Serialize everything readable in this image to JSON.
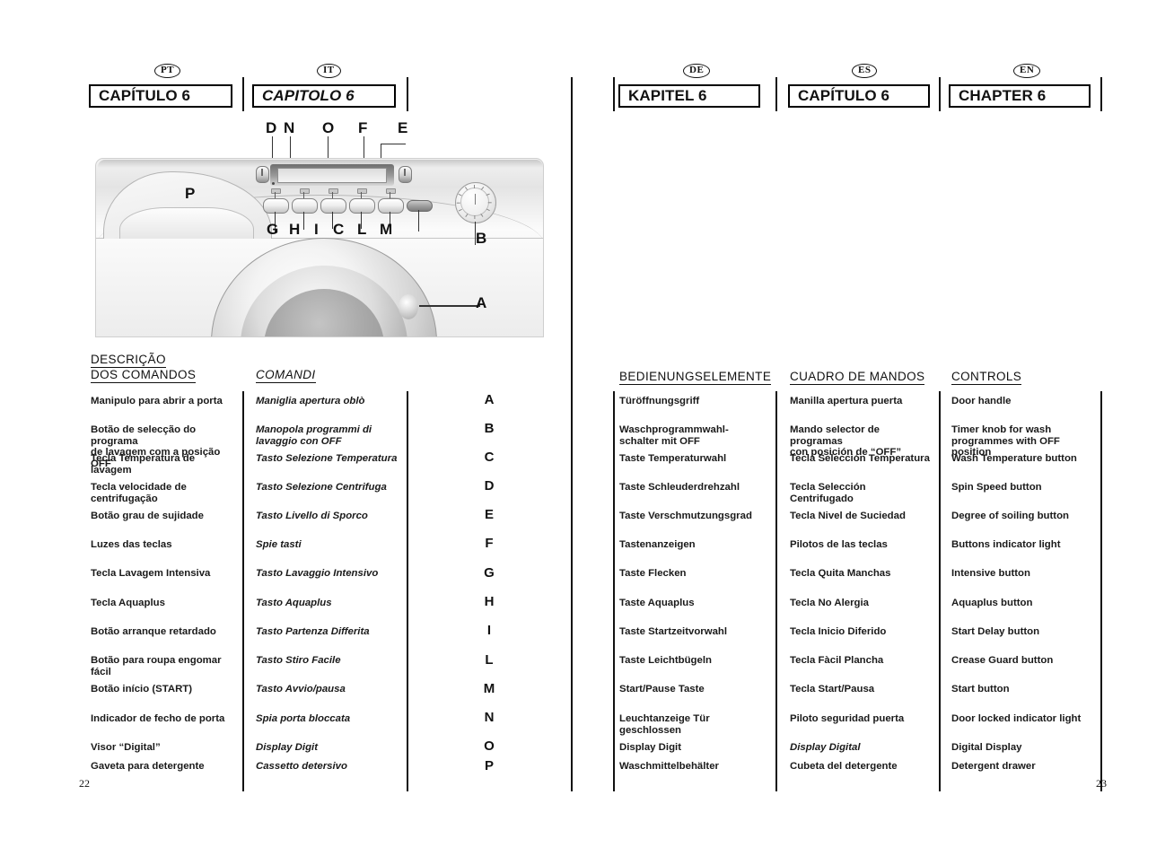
{
  "document": {
    "left_page_number": "22",
    "right_page_number": "23"
  },
  "languages": [
    {
      "code": "PT",
      "chapter": "CAPÍTULO 6",
      "italic": false
    },
    {
      "code": "IT",
      "chapter": "CAPITOLO 6",
      "italic": true
    },
    {
      "code": "DE",
      "chapter": "KAPITEL 6",
      "italic": false
    },
    {
      "code": "ES",
      "chapter": "CAPÍTULO 6",
      "italic": false
    },
    {
      "code": "EN",
      "chapter": "CHAPTER 6",
      "italic": false
    }
  ],
  "section_headings": {
    "pt": "DESCRIÇÃO\nDOS COMANDOS",
    "it": "COMANDI",
    "de": "BEDIENUNGSELEMENTE",
    "es": "CUADRO DE MANDOS",
    "en": "CONTROLS"
  },
  "key_letters": [
    "A",
    "B",
    "C",
    "D",
    "E",
    "F",
    "G",
    "H",
    "I",
    "L",
    "M",
    "N",
    "O",
    "P"
  ],
  "controls": [
    {
      "key": "A",
      "pt": "Manipulo para abrir a porta",
      "it": "Maniglia apertura oblò",
      "de": "Türöffnungsgriff",
      "es": "Manilla apertura puerta",
      "en": "Door handle"
    },
    {
      "key": "B",
      "pt": "Botão de selecção do programa\nde lavagem com a posição OFF",
      "it": "Manopola programmi di\nlavaggio con OFF",
      "de": "Waschprogrammwahl-\nschalter mit OFF",
      "es": "Mando selector de programas\ncon posición de “OFF”",
      "en": "Timer knob for wash\nprogrammes with OFF position"
    },
    {
      "key": "C",
      "pt": "Tecla Temperatura de\nlavagem",
      "it": "Tasto Selezione Temperatura",
      "de": "Taste Temperaturwahl",
      "es": "Tecla Selección Temperatura",
      "en": "Wash Temperature button"
    },
    {
      "key": "D",
      "pt": "Tecla velocidade de\ncentrifugação",
      "it": "Tasto Selezione Centrifuga",
      "de": "Taste Schleuderdrehzahl",
      "es": "Tecla Selección\nCentrifugado",
      "en": "Spin Speed button"
    },
    {
      "key": "E",
      "pt": "Botão grau de sujidade",
      "it": "Tasto Livello di Sporco",
      "de": "Taste Verschmutzungsgrad",
      "es": "Tecla Nivel de Suciedad",
      "en": "Degree of soiling button"
    },
    {
      "key": "F",
      "pt": "Luzes das teclas",
      "it": "Spie tasti",
      "de": "Tastenanzeigen",
      "es": "Pilotos de las teclas",
      "en": "Buttons indicator light"
    },
    {
      "key": "G",
      "pt": "Tecla Lavagem Intensiva",
      "it": "Tasto Lavaggio Intensivo",
      "de": "Taste Flecken",
      "es": "Tecla Quita Manchas",
      "en": "Intensive button"
    },
    {
      "key": "H",
      "pt": "Tecla Aquaplus",
      "it": "Tasto Aquaplus",
      "de": "Taste Aquaplus",
      "es": "Tecla No Alergia",
      "en": "Aquaplus button"
    },
    {
      "key": "I",
      "pt": "Botão arranque retardado",
      "it": "Tasto Partenza Differita",
      "de": "Taste Startzeitvorwahl",
      "es": "Tecla Inicio Diferido",
      "en": "Start Delay button"
    },
    {
      "key": "L",
      "pt": "Botão para roupa engomar\nfácil",
      "it": "Tasto Stiro Facile",
      "de": "Taste Leichtbügeln",
      "es": "Tecla Fàcil Plancha",
      "en": "Crease Guard button"
    },
    {
      "key": "M",
      "pt": "Botão início (START)",
      "it": "Tasto Avvio/pausa",
      "de": "Start/Pause Taste",
      "es": "Tecla Start/Pausa",
      "en": "Start button"
    },
    {
      "key": "N",
      "pt": "Indicador de fecho de porta",
      "it": "Spia porta bloccata",
      "de": "Leuchtanzeige Tür\ngeschlossen",
      "es": "Piloto seguridad puerta",
      "en": "Door locked indicator light"
    },
    {
      "key": "O",
      "pt": "Visor “Digital”",
      "it": "Display Digit",
      "de": "Display Digit",
      "es": "Display Digital",
      "en": "Digital Display"
    },
    {
      "key": "P",
      "pt": "Gaveta para detergente",
      "it": "Cassetto detersivo",
      "de": "Waschmittelbehälter",
      "es": "Cubeta del detergente",
      "en": "Detergent drawer"
    }
  ],
  "diagram": {
    "caption": "Washing machine control panel with lettered callouts",
    "callouts": [
      "D",
      "N",
      "O",
      "F",
      "E",
      "P",
      "G",
      "H",
      "I",
      "C",
      "L",
      "M",
      "B",
      "A"
    ]
  }
}
